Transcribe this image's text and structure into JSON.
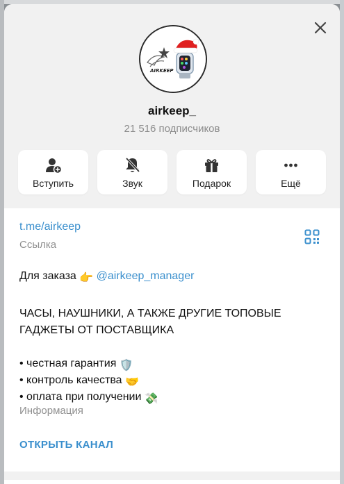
{
  "channel": {
    "name": "airkeep_",
    "subscribers": "21 516 подписчиков",
    "avatar_text": "AIRKEEP"
  },
  "actions": [
    {
      "label": "Вступить",
      "icon": "add-user-icon"
    },
    {
      "label": "Звук",
      "icon": "bell-off-icon"
    },
    {
      "label": "Подарок",
      "icon": "gift-icon"
    },
    {
      "label": "Ещё",
      "icon": "more-icon"
    }
  ],
  "info": {
    "link": "t.me/airkeep",
    "link_label": "Ссылка",
    "order_prefix": "Для заказа",
    "order_emoji": "👉",
    "order_mention": "@airkeep_manager",
    "description_line1": "ЧАСЫ, НАУШНИКИ, А ТАКЖЕ ДРУГИЕ ТОПОВЫЕ",
    "description_line2": "ГАДЖЕТЫ ОТ ПОСТАВЩИКА",
    "bullets": [
      {
        "text": "• честная гарантия",
        "emoji": "🛡️"
      },
      {
        "text": "• контроль качества",
        "emoji": "🤝"
      },
      {
        "text": "• оплата при получении",
        "emoji": "💸"
      }
    ],
    "info_label": "Информация",
    "open_channel": "ОТКРЫТЬ КАНАЛ"
  },
  "colors": {
    "accent": "#3a8fcd",
    "header_bg": "#f1f1f1",
    "muted_text": "#909090"
  }
}
